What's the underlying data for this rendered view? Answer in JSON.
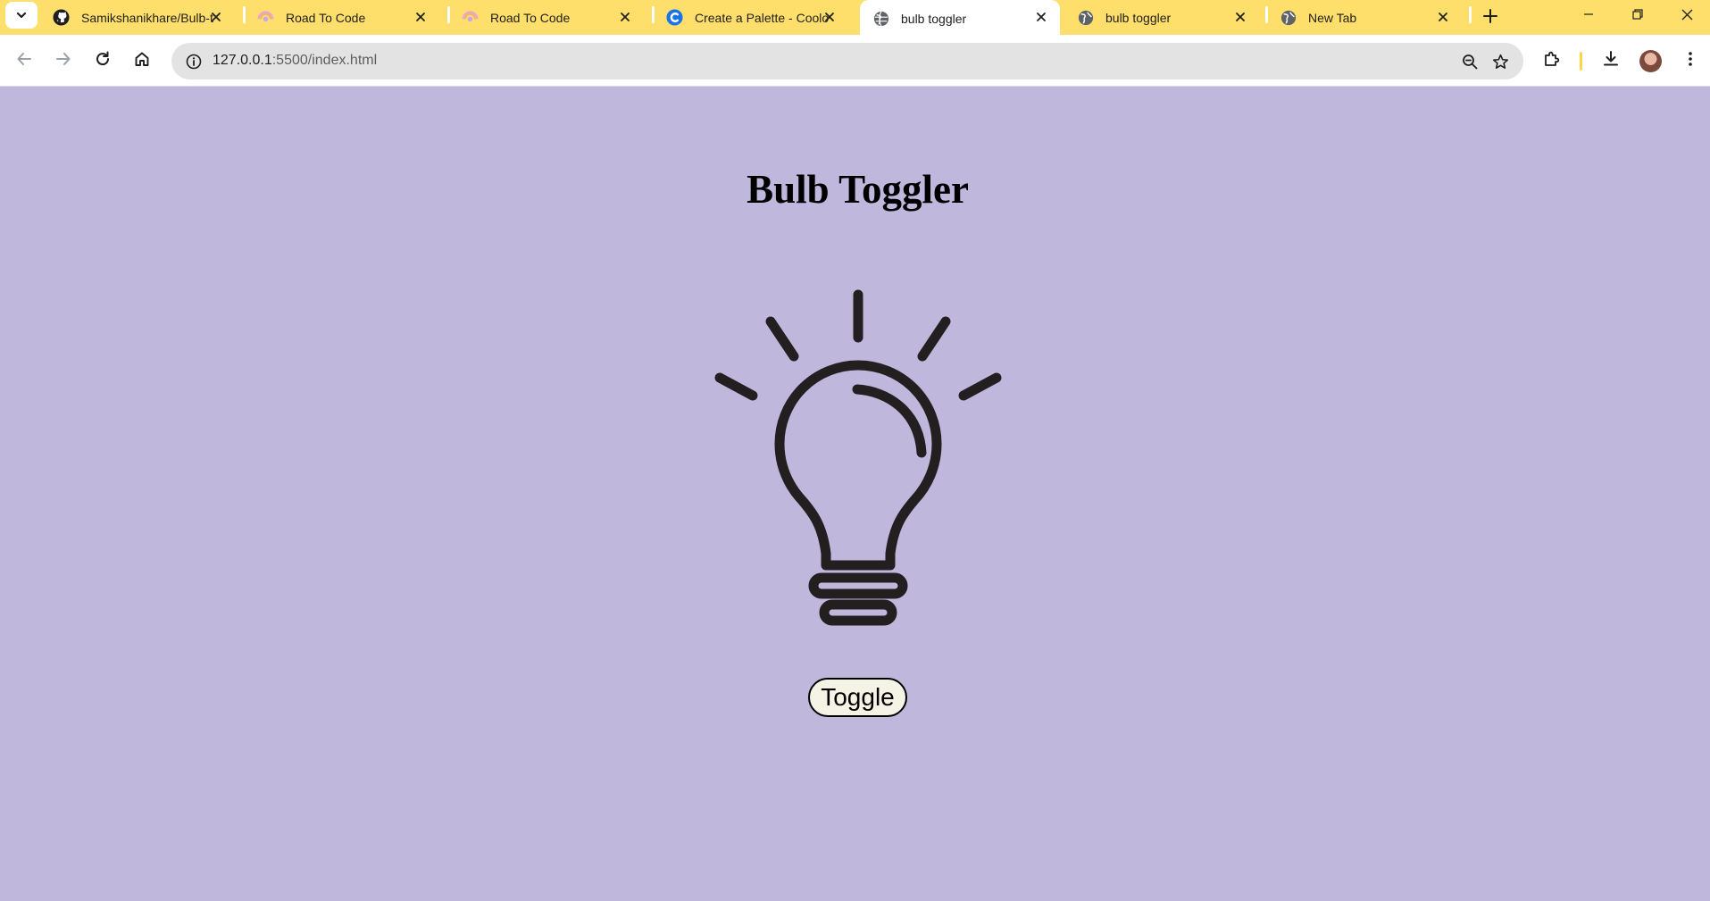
{
  "browser": {
    "tabs": [
      {
        "title": "Samikshanikhare/Bulb-t",
        "favicon": "github-icon",
        "active": false
      },
      {
        "title": "Road To Code",
        "favicon": "road-to-code-icon",
        "active": false
      },
      {
        "title": "Road To Code",
        "favicon": "road-to-code-icon",
        "active": false
      },
      {
        "title": "Create a Palette - Coolo",
        "favicon": "coolors-icon",
        "active": false
      },
      {
        "title": "bulb toggler",
        "favicon": "globe-icon",
        "active": true
      },
      {
        "title": "bulb toggler",
        "favicon": "globe-icon",
        "active": false
      },
      {
        "title": "New Tab",
        "favicon": "globe-icon",
        "active": false
      }
    ],
    "url_host": "127.0.0.1",
    "url_rest": ":5500/index.html",
    "colors": {
      "tabstrip": "#ffdf6b",
      "page_background": "#bfb7dc",
      "omnibox": "#e3e3e3"
    }
  },
  "page": {
    "heading": "Bulb Toggler",
    "bulb_state": "off",
    "toggle_label": "Toggle"
  }
}
